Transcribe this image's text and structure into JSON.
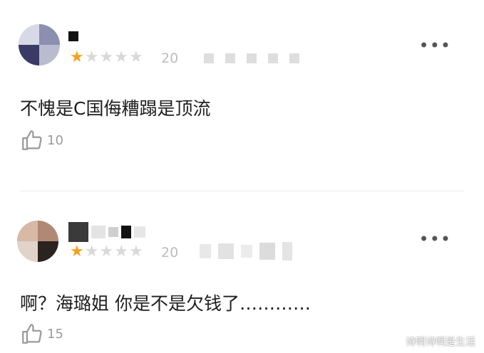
{
  "reviews": [
    {
      "date_prefix": "20",
      "rating": 1,
      "max_rating": 5,
      "text": "不愧是C国侮糟蹋是顶流",
      "likes": "10",
      "more_label": "•••"
    },
    {
      "date_prefix": "20",
      "rating": 1,
      "max_rating": 5,
      "text": "啊？海璐姐 你是不是欠钱了…………",
      "likes": "15",
      "more_label": "•••"
    }
  ],
  "watermark": "诗啊诗啊是生活",
  "colors": {
    "star_on": "#f6a021",
    "star_off": "#d9d9d9"
  }
}
